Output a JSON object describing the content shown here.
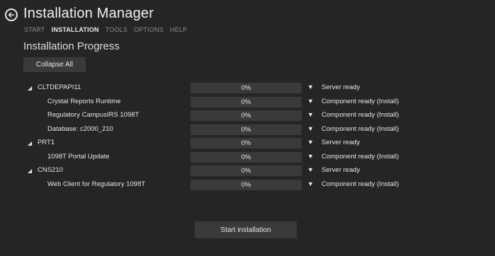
{
  "app": {
    "title": "Installation Manager"
  },
  "nav": [
    "START",
    "INSTALLATION",
    "TOOLS",
    "OPTIONS",
    "HELP"
  ],
  "nav_active": "INSTALLATION",
  "section_title": "Installation Progress",
  "collapse_label": "Collapse All",
  "rows": [
    {
      "kind": "server",
      "name": "CLTDEPAPI11",
      "progress": "0%",
      "progress_value": 0,
      "status": "Server ready"
    },
    {
      "kind": "component",
      "name": "Crystal Reports Runtime",
      "progress": "0%",
      "progress_value": 0,
      "status": "Component ready (Install)"
    },
    {
      "kind": "component",
      "name": "Regulatory CampusIRS 1098T",
      "progress": "0%",
      "progress_value": 0,
      "status": "Component ready (Install)"
    },
    {
      "kind": "component",
      "name": "Database: c2000_210",
      "progress": "0%",
      "progress_value": 0,
      "status": "Component ready (Install)"
    },
    {
      "kind": "server",
      "name": "PRT1",
      "progress": "0%",
      "progress_value": 0,
      "status": "Server ready"
    },
    {
      "kind": "component",
      "name": "1098T Portal Update",
      "progress": "0%",
      "progress_value": 0,
      "status": "Component ready (Install)"
    },
    {
      "kind": "server",
      "name": "CNS210",
      "progress": "0%",
      "progress_value": 0,
      "status": "Server ready"
    },
    {
      "kind": "component",
      "name": "Web Client for Regulatory 1098T",
      "progress": "0%",
      "progress_value": 0,
      "status": "Component ready (Install)"
    }
  ],
  "start_label": "Start installation",
  "icons": {
    "back": "back-arrow-icon",
    "expand": "triangle-down-icon",
    "tree": "tree-node-icon"
  }
}
